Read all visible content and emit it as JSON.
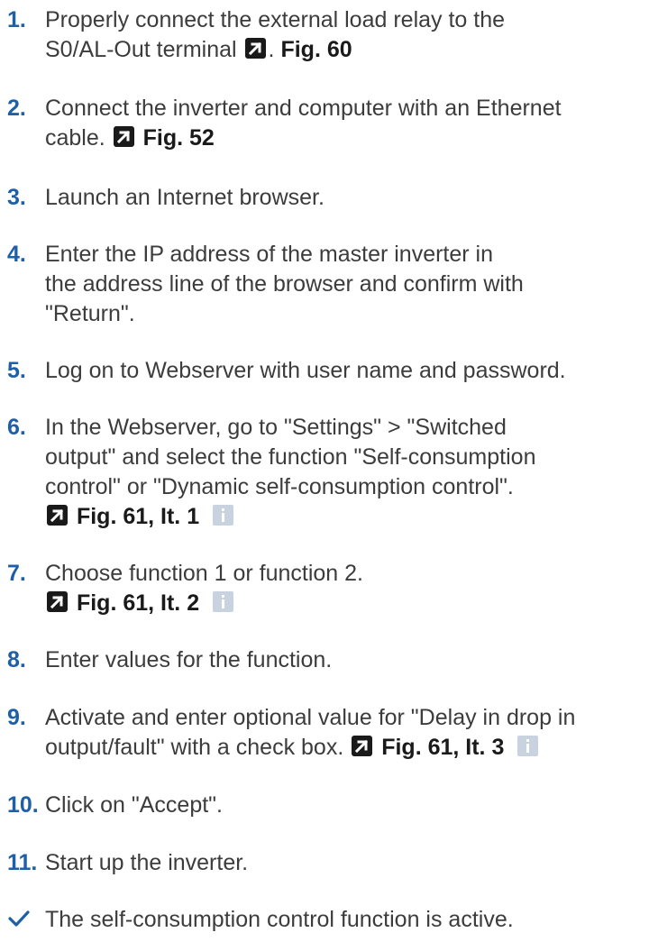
{
  "steps": [
    {
      "num": "1.",
      "line1": "Properly connect the external load relay to the",
      "line2a": "S0/AL-Out terminal",
      "line2b": ".",
      "ref": "Fig. 60"
    },
    {
      "num": "2.",
      "line1": "Connect the inverter and computer with an Ethernet",
      "line2a": "cable.",
      "ref": "Fig. 52"
    },
    {
      "num": "3.",
      "line1": "Launch an Internet browser."
    },
    {
      "num": "4.",
      "line1": "Enter the IP address of the master inverter in",
      "line2": "the address line of the browser and confirm with",
      "line3": "\"Return\"."
    },
    {
      "num": "5.",
      "line1": "Log on to Webserver with user name and password."
    },
    {
      "num": "6.",
      "line1": "In the Webserver, go to \"Settings\" > \"Switched",
      "line2": "output\" and select the function \"Self-consumption",
      "line3": "control\" or \"Dynamic self-consumption control\".",
      "ref": "Fig. 61, It. 1"
    },
    {
      "num": "7.",
      "line1": "Choose function 1 or function 2.",
      "ref": "Fig. 61, It. 2"
    },
    {
      "num": "8.",
      "line1": "Enter values for the function."
    },
    {
      "num": "9.",
      "line1": "Activate and enter optional value for \"Delay in drop in",
      "line2a": "output/fault\" with a check box.",
      "ref": "Fig. 61, It. 3"
    },
    {
      "num": "10.",
      "line1": "Click on \"Accept\"."
    },
    {
      "num": "11.",
      "line1": "Start up the inverter."
    }
  ],
  "result": "The self-consumption control function is active.",
  "icons": {
    "link": "arrow-link-icon",
    "info": "info-icon",
    "check": "checkmark-icon"
  },
  "colors": {
    "number": "#1f5fa8",
    "text": "#3c3c3c",
    "info_bg": "#c9d3df"
  }
}
